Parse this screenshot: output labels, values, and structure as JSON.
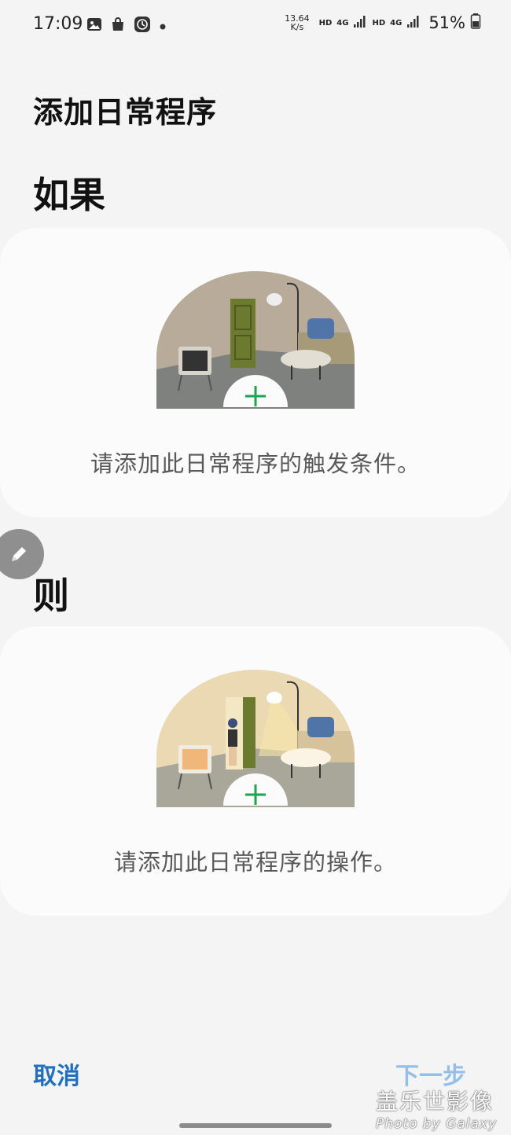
{
  "status_bar": {
    "time": "17:09",
    "net_speed_value": "13.64",
    "net_speed_unit": "K/s",
    "sim1_hd": "HD",
    "sim1_network": "4G",
    "sim2_hd": "HD",
    "sim2_network": "4G",
    "battery": "51%",
    "icons": [
      "gallery-icon",
      "shopping-bag-icon",
      "clock-app-icon",
      "notification-dot-icon"
    ]
  },
  "page": {
    "title": "添加日常程序"
  },
  "if_section": {
    "label": "如果",
    "prompt": "请添加此日常程序的触发条件。"
  },
  "then_section": {
    "label": "则",
    "prompt": "请添加此日常程序的操作。"
  },
  "footer": {
    "cancel_label": "取消",
    "next_label": "下一步"
  },
  "watermark": {
    "line1": "盖乐世影像",
    "line2": "Photo by Galaxy"
  },
  "colors": {
    "accent": "#1f6fc2",
    "next_disabled": "#93bfe8",
    "plus_green": "#1aa64a",
    "background": "#f4f4f4",
    "card": "#fbfbfb"
  }
}
